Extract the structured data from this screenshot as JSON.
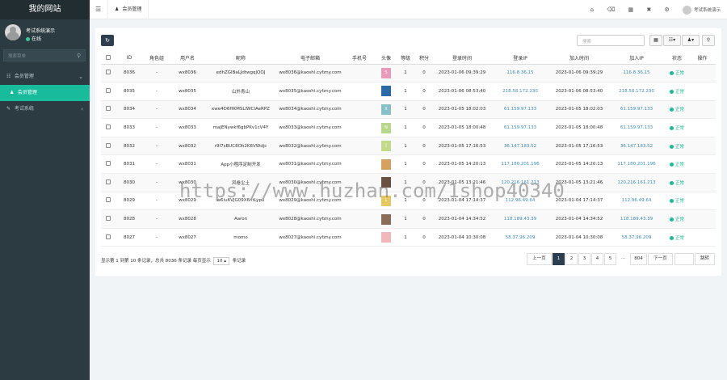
{
  "sidebar": {
    "logo": "我的网站",
    "user_name": "考试系统演示",
    "user_status": "在线",
    "search_placeholder": "搜索菜单",
    "menu": [
      {
        "label": "会员管理",
        "icon": "users-icon",
        "arrow": "⌄"
      },
      {
        "label": "会员管理",
        "icon": "user-icon",
        "active": true
      },
      {
        "label": "考试系统",
        "icon": "exam-icon",
        "arrow": "‹"
      }
    ]
  },
  "topbar": {
    "tab_label": "会员管理",
    "user_label": "考试系统演示"
  },
  "toolbar": {
    "search_placeholder": "搜索"
  },
  "table": {
    "headers": [
      "ID",
      "角色组",
      "用户名",
      "昵称",
      "电子邮箱",
      "手机号",
      "头像",
      "等级",
      "积分",
      "登录时间",
      "登录IP",
      "加入时间",
      "加入IP",
      "状态",
      "操作"
    ],
    "rows": [
      {
        "id": "8036",
        "group": "-",
        "username": "wx8036",
        "nickname": "edhZGlBaLJdtwgqjQOJ",
        "email": "wx8036@kaoshi.cyfzny.com",
        "mobile": "",
        "avatar_color": "#e89ab8",
        "avatar_text": "S",
        "level": "1",
        "score": "0",
        "logintime": "2023-01-06 09:39:29",
        "loginip": "116.8.36.15",
        "jointime": "2023-01-06 09:39:29",
        "joinip": "116.8.36.15",
        "status": "正常"
      },
      {
        "id": "8035",
        "group": "-",
        "username": "wx8035",
        "nickname": "山外青山",
        "email": "wx8035@kaoshi.cyfzny.com",
        "mobile": "",
        "avatar_color": "#2a6aa8",
        "avatar_text": "",
        "level": "1",
        "score": "0",
        "logintime": "2023-01-06 08:53:40",
        "loginip": "218.58.172.230",
        "jointime": "2023-01-06 08:53:40",
        "joinip": "218.58.172.230",
        "status": "正常"
      },
      {
        "id": "8034",
        "group": "-",
        "username": "wx8034",
        "nickname": "xwe4D6HKMSLIWCIAeRPZ",
        "email": "wx8034@kaoshi.cyfzny.com",
        "mobile": "",
        "avatar_color": "#88c0c8",
        "avatar_text": "X",
        "level": "1",
        "score": "0",
        "logintime": "2023-01-05 18:02:03",
        "loginip": "61.159.97.133",
        "jointime": "2023-01-05 18:02:03",
        "joinip": "61.159.97.133",
        "status": "正常"
      },
      {
        "id": "8033",
        "group": "-",
        "username": "wx8033",
        "nickname": "maJENywkf6gbPKv1cV4Y",
        "email": "wx8033@kaoshi.cyfzny.com",
        "mobile": "",
        "avatar_color": "#b7d88a",
        "avatar_text": "N",
        "level": "1",
        "score": "0",
        "logintime": "2023-01-05 18:00:48",
        "loginip": "61.159.97.133",
        "jointime": "2023-01-05 18:00:48",
        "joinip": "61.159.97.133",
        "status": "正常"
      },
      {
        "id": "8032",
        "group": "-",
        "username": "wx8032",
        "nickname": "r9I7sBUC8Oh2K6VWdjc",
        "email": "wx8032@kaoshi.cyfzny.com",
        "mobile": "",
        "avatar_color": "#c4d98a",
        "avatar_text": "J",
        "level": "1",
        "score": "0",
        "logintime": "2023-01-05 17:16:53",
        "loginip": "36.147.183.52",
        "jointime": "2023-01-05 17:16:53",
        "joinip": "36.147.183.52",
        "status": "正常"
      },
      {
        "id": "8031",
        "group": "-",
        "username": "wx8031",
        "nickname": "App小程序定制开发",
        "email": "wx8031@kaoshi.cyfzny.com",
        "mobile": "",
        "avatar_color": "#d6a060",
        "avatar_text": "",
        "level": "1",
        "score": "0",
        "logintime": "2023-01-05 14:20:13",
        "loginip": "117.180.201.196",
        "jointime": "2023-01-05 14:20:13",
        "joinip": "117.180.201.196",
        "status": "正常"
      },
      {
        "id": "8030",
        "group": "-",
        "username": "wx8030",
        "nickname": "风卷尘土",
        "email": "wx8030@kaoshi.cyfzny.com",
        "mobile": "",
        "avatar_color": "#6a5040",
        "avatar_text": "",
        "level": "1",
        "score": "0",
        "logintime": "2023-01-05 13:21:46",
        "loginip": "120.216.161.213",
        "jointime": "2023-01-05 13:21:46",
        "joinip": "120.216.161.213",
        "status": "正常"
      },
      {
        "id": "8029",
        "group": "-",
        "username": "wx8029",
        "nickname": "w6iu6VJG09X6ntLypu",
        "email": "wx8029@kaoshi.cyfzny.com",
        "mobile": "",
        "avatar_color": "#e6c860",
        "avatar_text": "L",
        "level": "1",
        "score": "0",
        "logintime": "2023-01-04 17:14:37",
        "loginip": "112.96.49.64",
        "jointime": "2023-01-04 17:14:37",
        "joinip": "112.96.49.64",
        "status": "正常"
      },
      {
        "id": "8028",
        "group": "-",
        "username": "wx8028",
        "nickname": "Aaron",
        "email": "wx8028@kaoshi.cyfzny.com",
        "mobile": "",
        "avatar_color": "#8a6e5a",
        "avatar_text": "",
        "level": "1",
        "score": "0",
        "logintime": "2023-01-04 14:34:52",
        "loginip": "118.189.43.39",
        "jointime": "2023-01-04 14:34:52",
        "joinip": "118.189.43.39",
        "status": "正常"
      },
      {
        "id": "8027",
        "group": "-",
        "username": "wx8027",
        "nickname": "momo",
        "email": "wx8027@kaoshi.cyfzny.com",
        "mobile": "",
        "avatar_color": "#f0b8b8",
        "avatar_text": "",
        "level": "1",
        "score": "0",
        "logintime": "2023-01-04 10:30:08",
        "loginip": "58.37.96.209",
        "jointime": "2023-01-04 10:30:08",
        "joinip": "58.37.96.209",
        "status": "正常"
      }
    ]
  },
  "footer": {
    "summary_prefix": "显示第 1 到第 10 条记录，总共 8036 条记录 每页显示",
    "page_size": "10 ▴",
    "summary_suffix": "条记录"
  },
  "pagination": {
    "prev": "上一页",
    "pages": [
      "1",
      "2",
      "3",
      "4",
      "5",
      "...",
      "804"
    ],
    "next": "下一页",
    "go": "跳转"
  },
  "watermark": "https://www.huzhan.com/1shop40340"
}
